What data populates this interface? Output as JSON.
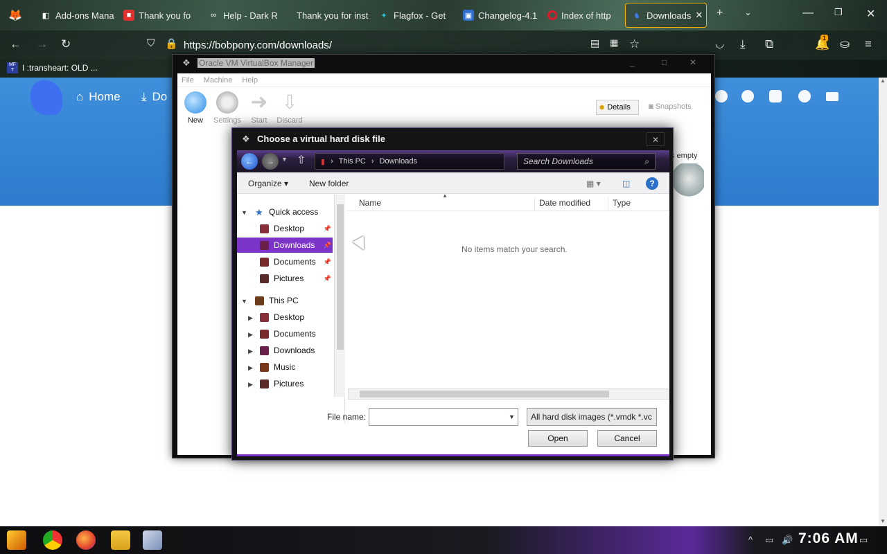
{
  "browser": {
    "tabs": [
      {
        "label": "Add-ons Mana",
        "icon": "puzzle-icon"
      },
      {
        "label": "Thank you fo",
        "icon": "lock-icon",
        "color": "#e0312f"
      },
      {
        "label": "Help - Dark R",
        "icon": "mask-icon"
      },
      {
        "label": "Thank you for inst",
        "icon": "blank-icon"
      },
      {
        "label": "Flagfox - Get",
        "icon": "fox-icon",
        "color": "#26c6da"
      },
      {
        "label": "Changelog-4.1",
        "icon": "image-icon",
        "color": "#2f6fd0"
      },
      {
        "label": "Index of http",
        "icon": "opera-icon",
        "color": "#e01a2b"
      },
      {
        "label": "Downloads",
        "icon": "pony-icon",
        "color": "#3e7bf0"
      }
    ],
    "url": "https://bobpony.com/downloads/",
    "bookmark": "I :transheart: OLD ...",
    "bookmark_icon_text": "MF\nT",
    "notification_count": "1"
  },
  "website": {
    "nav": [
      {
        "label": "Home",
        "icon": "home-icon"
      },
      {
        "label": "Do",
        "icon": "download-icon"
      }
    ],
    "social_icons": [
      "twitter-icon",
      "mastodon-icon",
      "discord-icon",
      "github-icon",
      "mail-icon"
    ]
  },
  "vbox": {
    "title": "Oracle VM VirtualBox Manager",
    "menu": [
      "File",
      "Machine",
      "Help"
    ],
    "toolbar": [
      "New",
      "Settings",
      "Start",
      "Discard"
    ],
    "details": "Details",
    "snapshots": "Snapshots",
    "empty_text": "s empty"
  },
  "dialog": {
    "title": "Choose a virtual hard disk file",
    "breadcrumb": [
      "This PC",
      "Downloads"
    ],
    "search_placeholder": "Search Downloads",
    "organize": "Organize",
    "new_folder": "New folder",
    "nav": {
      "quick_access": "Quick access",
      "quick_items": [
        "Desktop",
        "Downloads",
        "Documents",
        "Pictures"
      ],
      "this_pc": "This PC",
      "pc_items": [
        "Desktop",
        "Documents",
        "Downloads",
        "Music",
        "Pictures"
      ]
    },
    "columns": [
      "Name",
      "Date modified",
      "Type"
    ],
    "empty_message": "No items match your search.",
    "file_name_label": "File name:",
    "file_name_value": "",
    "file_type": "All hard disk images (*.vmdk *.vc",
    "open": "Open",
    "cancel": "Cancel"
  },
  "taskbar": {
    "apps": [
      "start-icon",
      "chrome-icon",
      "firefox-icon",
      "file-explorer-icon",
      "virtualbox-icon"
    ],
    "time": "7:06 AM"
  },
  "colors": {
    "accent": "#7b33c8",
    "site_blue": "#3a86d8",
    "selection": "#7b33c8"
  }
}
